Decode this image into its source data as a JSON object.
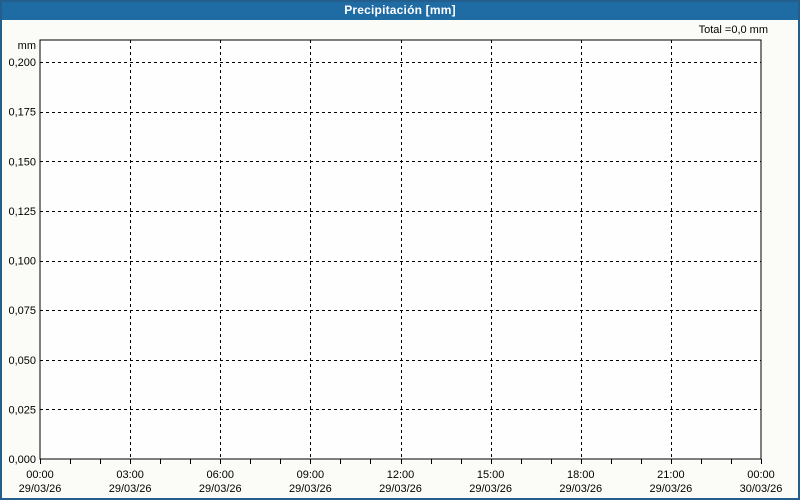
{
  "window": {
    "title": "Precipitación [mm]"
  },
  "colors": {
    "titlebar_bg": "#1f6ba4",
    "titlebar_text": "#ffffff",
    "window_border": "#235e8c",
    "window_bg": "#fbfbf7",
    "plot_bg": "#fefefe",
    "axis": "#000000",
    "grid": "#000000",
    "label_text": "#000000"
  },
  "chart_data": {
    "type": "bar",
    "title": "Precipitación [mm]",
    "total_label": "Total =0,0 mm",
    "total_value_mm": 0.0,
    "grid": "dashed",
    "legend_position": "none",
    "y_axis": {
      "unit_label": "mm",
      "tick_labels": [
        "0,200",
        "0,175",
        "0,150",
        "0,125",
        "0,100",
        "0,075",
        "0,050",
        "0,025",
        "0,000"
      ],
      "tick_values": [
        0.2,
        0.175,
        0.15,
        0.125,
        0.1,
        0.075,
        0.05,
        0.025,
        0.0
      ],
      "min": 0.0,
      "max": 0.2111
    },
    "x_axis": {
      "range_hours": [
        0,
        24
      ],
      "major_tick_hours": [
        0,
        3,
        6,
        9,
        12,
        15,
        18,
        21,
        24
      ],
      "minor_tick_interval_hours": 1,
      "tick_labels": [
        {
          "time": "00:00",
          "date": "29/03/26"
        },
        {
          "time": "03:00",
          "date": "29/03/26"
        },
        {
          "time": "06:00",
          "date": "29/03/26"
        },
        {
          "time": "09:00",
          "date": "29/03/26"
        },
        {
          "time": "12:00",
          "date": "29/03/26"
        },
        {
          "time": "15:00",
          "date": "29/03/26"
        },
        {
          "time": "18:00",
          "date": "29/03/26"
        },
        {
          "time": "21:00",
          "date": "29/03/26"
        },
        {
          "time": "00:00",
          "date": "30/03/26"
        }
      ]
    },
    "series": [
      {
        "name": "Precipitación",
        "unit": "mm",
        "values": []
      }
    ]
  }
}
